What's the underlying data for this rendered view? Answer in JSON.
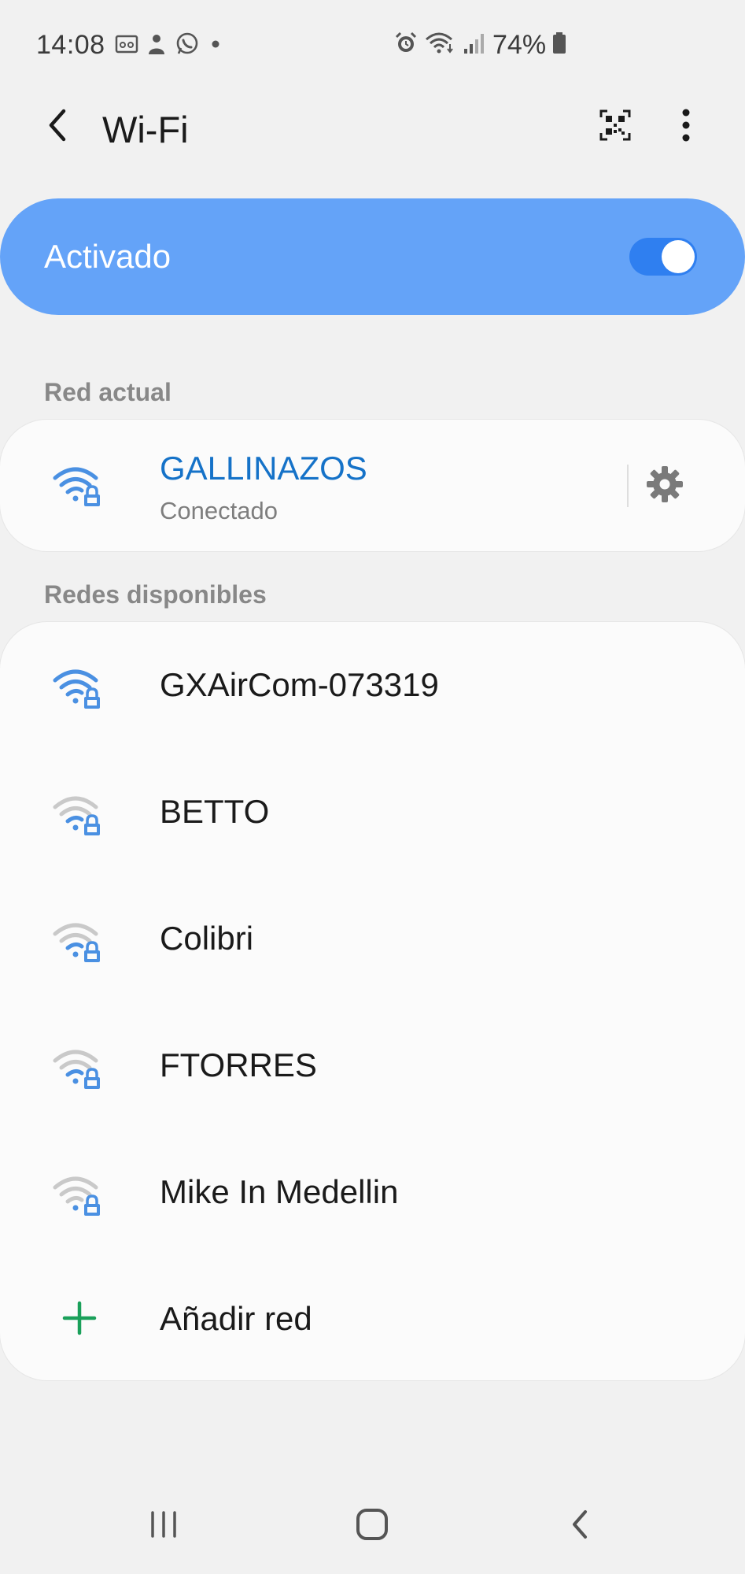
{
  "status_bar": {
    "time": "14:08",
    "battery_percent": "74%",
    "left_icons": [
      "gallery-icon",
      "profile-icon",
      "whatsapp-icon",
      "dot-icon"
    ],
    "right_icons": [
      "alarm-icon",
      "wifi-icon",
      "signal-icon",
      "battery-icon"
    ]
  },
  "app_bar": {
    "title": "Wi-Fi"
  },
  "master_switch": {
    "label": "Activado",
    "on": true
  },
  "current_network": {
    "section_title": "Red actual",
    "name": "GALLINAZOS",
    "status": "Conectado"
  },
  "available": {
    "section_title": "Redes disponibles",
    "networks": [
      {
        "name": "GXAirCom-073319",
        "signal": 4
      },
      {
        "name": "BETTO",
        "signal": 2
      },
      {
        "name": "Colibri",
        "signal": 2
      },
      {
        "name": "FTORRES",
        "signal": 2
      },
      {
        "name": "Mike In Medellin",
        "signal": 1
      }
    ],
    "add_label": "Añadir red"
  },
  "colors": {
    "accent": "#1572c8",
    "switch_bg": "#64a3f8",
    "toggle": "#2f7ff0",
    "wifi_active": "#4a90e2",
    "wifi_dim": "#c9c9c9",
    "add_green": "#1aa05a"
  }
}
